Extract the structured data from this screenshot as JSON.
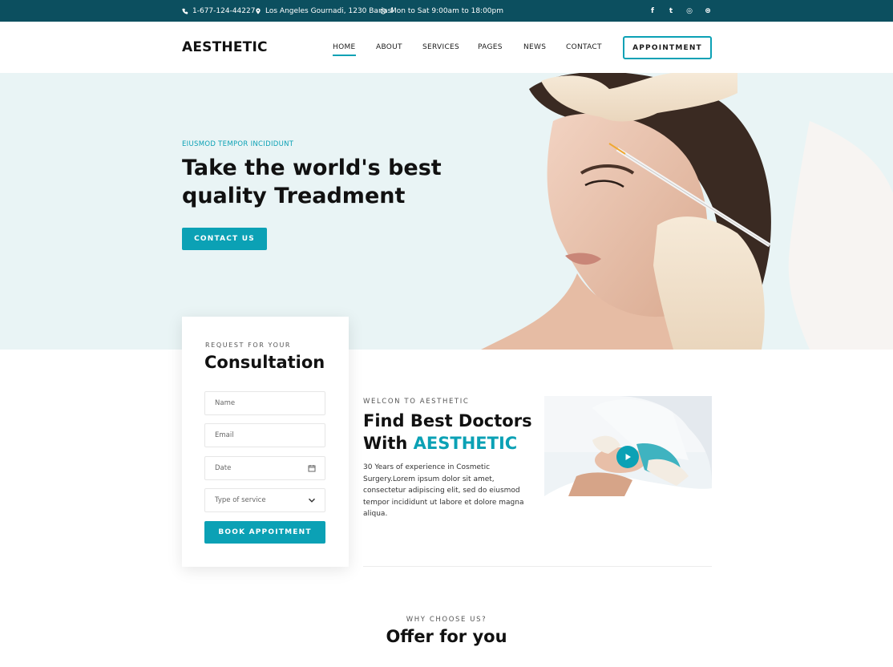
{
  "topbar": {
    "phone": "1-677-124-44227",
    "address": "Los Angeles Gournadi, 1230 Bariasl",
    "hours": "Mon to Sat 9:00am to 18:00pm",
    "socials": [
      {
        "icon": "facebook-icon",
        "glyph": "f"
      },
      {
        "icon": "twitter-icon",
        "glyph": "t"
      },
      {
        "icon": "instagram-icon",
        "glyph": "◎"
      },
      {
        "icon": "dribbble-icon",
        "glyph": "⊛"
      }
    ]
  },
  "header": {
    "logo": "AESTHETIC",
    "nav": [
      "HOME",
      "ABOUT",
      "SERVICES",
      "PAGES",
      "NEWS",
      "CONTACT"
    ],
    "active_nav": "HOME",
    "appointment_label": "APPOINTMENT"
  },
  "hero": {
    "eyebrow": "EIUSMOD TEMPOR INCIDIDUNT",
    "title": "Take the world's best quality Treadment",
    "cta_label": "CONTACT US"
  },
  "consultation": {
    "eyebrow": "REQUEST FOR YOUR",
    "title": "Consultation",
    "fields": {
      "name": "Name",
      "email": "Email",
      "date": "Date",
      "service": "Type of service"
    },
    "submit_label": "BOOK APPOITMENT"
  },
  "about": {
    "eyebrow": "WELCON TO AESTHETIC",
    "title_line1": "Find Best Doctors",
    "title_prefix": "With ",
    "title_accent": "AESTHETIC",
    "body": "30 Years of experience in Cosmetic Surgery.Lorem ipsum dolor sit amet, consectetur adipiscing elit, sed do eiusmod tempor incididunt ut labore et dolore magna aliqua."
  },
  "offer": {
    "eyebrow": "WHY CHOOSE US?",
    "title": "Offer for you"
  },
  "colors": {
    "accent": "#0ba1b5",
    "topbar": "#0c4f5f",
    "hero_bg": "#e9f4f5"
  }
}
